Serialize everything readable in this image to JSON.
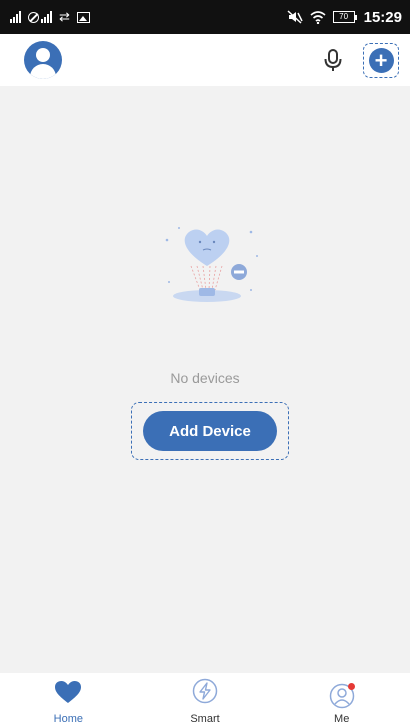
{
  "status_bar": {
    "signal_1_label": "ıll",
    "signal_2_label": "ıll",
    "battery_level": "70",
    "time": "15:29"
  },
  "header": {
    "avatar_icon": "user-avatar-icon",
    "mic_icon": "microphone-icon",
    "add_icon": "plus-circle-icon"
  },
  "main": {
    "empty_message": "No devices",
    "add_device_label": "Add Device"
  },
  "bottom_nav": {
    "items": [
      {
        "label": "Home",
        "icon": "heart-icon",
        "active": true
      },
      {
        "label": "Smart",
        "icon": "lightning-icon",
        "active": false
      },
      {
        "label": "Me",
        "icon": "profile-icon",
        "active": false,
        "badge": true
      }
    ]
  },
  "colors": {
    "accent": "#3b6fb6",
    "background": "#f2f2f2",
    "status_bar": "#111111",
    "badge": "#e53935",
    "muted_text": "#9a9a9a"
  }
}
